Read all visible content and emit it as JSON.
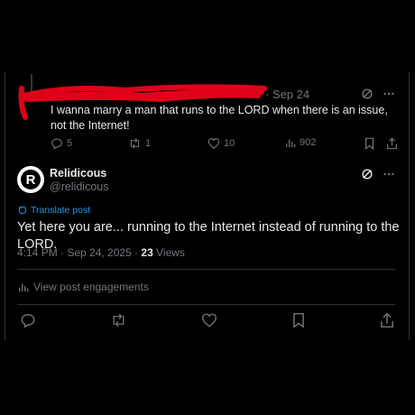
{
  "original_post": {
    "date": "· Sep 24",
    "text": "I wanna marry a man that runs to the LORD when there is an issue, not the Internet!",
    "stats": {
      "replies": "5",
      "reposts": "1",
      "likes": "10",
      "views": "902"
    }
  },
  "reply_post": {
    "avatar_letter": "R",
    "display_name": "Relidicous",
    "handle": "@relidicous",
    "translate_label": "Translate post",
    "text": "Yet here you are... running to the Internet instead of running to the LORD.",
    "timestamp": "4:14 PM · Sep 24, 2025 · ",
    "view_count": "23",
    "view_label": " Views",
    "engagements_label": "View post engagements"
  },
  "colors": {
    "background": "#000000",
    "text_primary": "#e7e9ea",
    "text_secondary": "#71767b",
    "link": "#1d9bf0",
    "redaction": "#e0001a"
  }
}
